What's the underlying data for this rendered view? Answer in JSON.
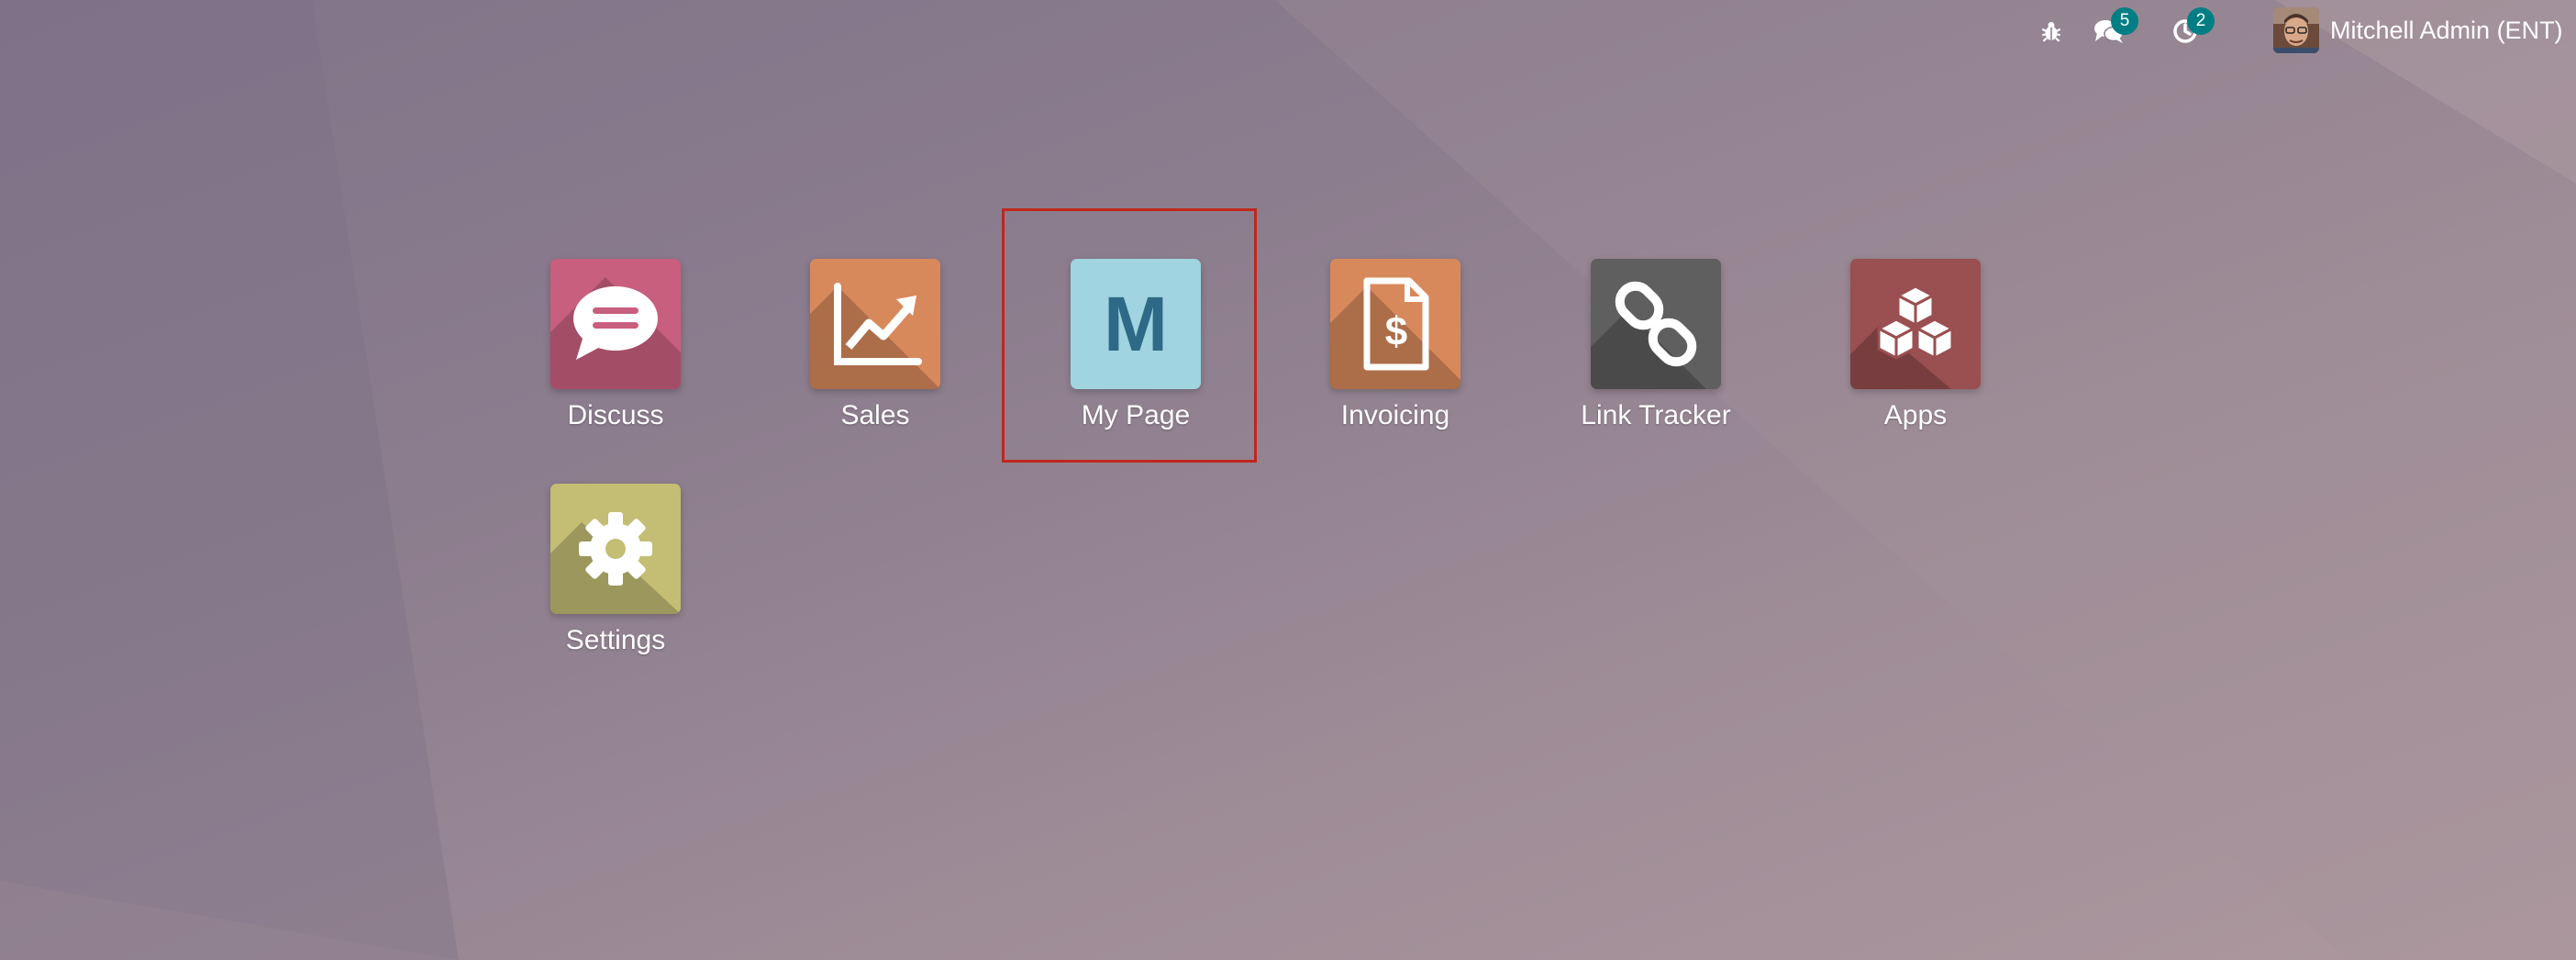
{
  "topbar": {
    "debug_icon": "bug-icon",
    "messages": {
      "icon": "chat-icon",
      "count": "5"
    },
    "activities": {
      "icon": "clock-icon",
      "count": "2"
    },
    "user": {
      "name": "Mitchell Admin (ENT)",
      "avatar": "user-avatar"
    }
  },
  "apps": [
    {
      "label": "Discuss",
      "icon": "chat-bubble-icon",
      "color": "#c85f7e"
    },
    {
      "label": "Sales",
      "icon": "trend-chart-icon",
      "color": "#d8895c"
    },
    {
      "label": "My Page",
      "icon": "letter-m-icon",
      "letter": "M",
      "color": "#9fd4e0"
    },
    {
      "label": "Invoicing",
      "icon": "invoice-dollar-icon",
      "color": "#d8895c"
    },
    {
      "label": "Link Tracker",
      "icon": "link-icon",
      "color": "#5f5f5f"
    },
    {
      "label": "Apps",
      "icon": "cubes-icon",
      "color": "#9a4f50"
    },
    {
      "label": "Settings",
      "icon": "gear-icon",
      "color": "#c4bd74"
    }
  ],
  "highlight": {
    "target": "My Page",
    "color": "#c0271c"
  },
  "colors": {
    "badge": "#017e84"
  }
}
